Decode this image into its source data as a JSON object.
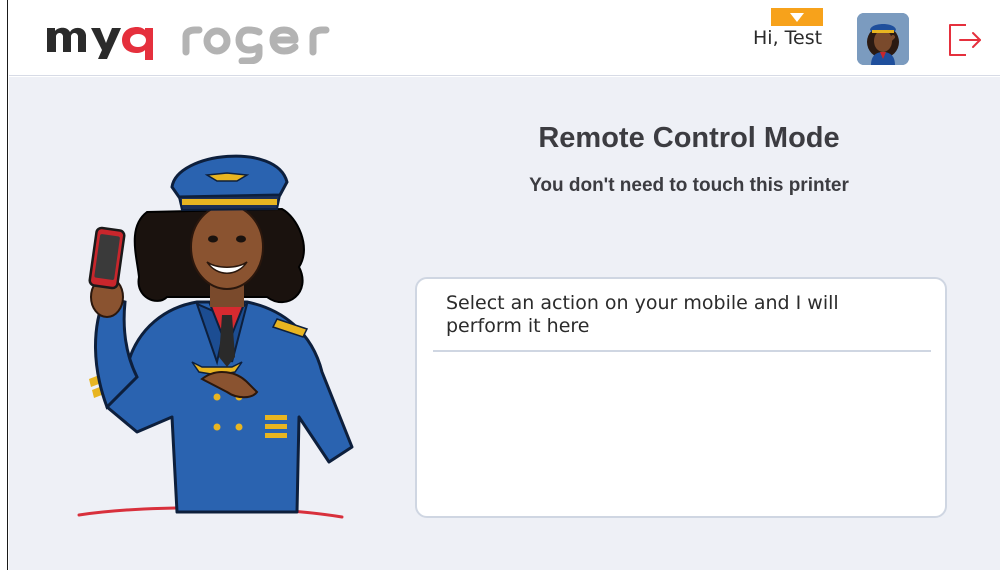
{
  "header": {
    "logo_myq": "myq",
    "logo_roger": "roger",
    "greeting": "Hi, Test",
    "accent_color": "#f7a21b",
    "brand_red": "#e5303d",
    "user_menu_icon": "chevron-down-icon",
    "logout_icon": "logout-icon"
  },
  "main": {
    "title": "Remote Control Mode",
    "subtitle": "You don't need to touch this printer",
    "instruction": "Select an action on your mobile and I will perform it here",
    "illustration": "pilot-mascot-illustration"
  },
  "colors": {
    "background": "#eef0f6",
    "card_border": "#cfd6e2",
    "text": "#3c3c41"
  }
}
